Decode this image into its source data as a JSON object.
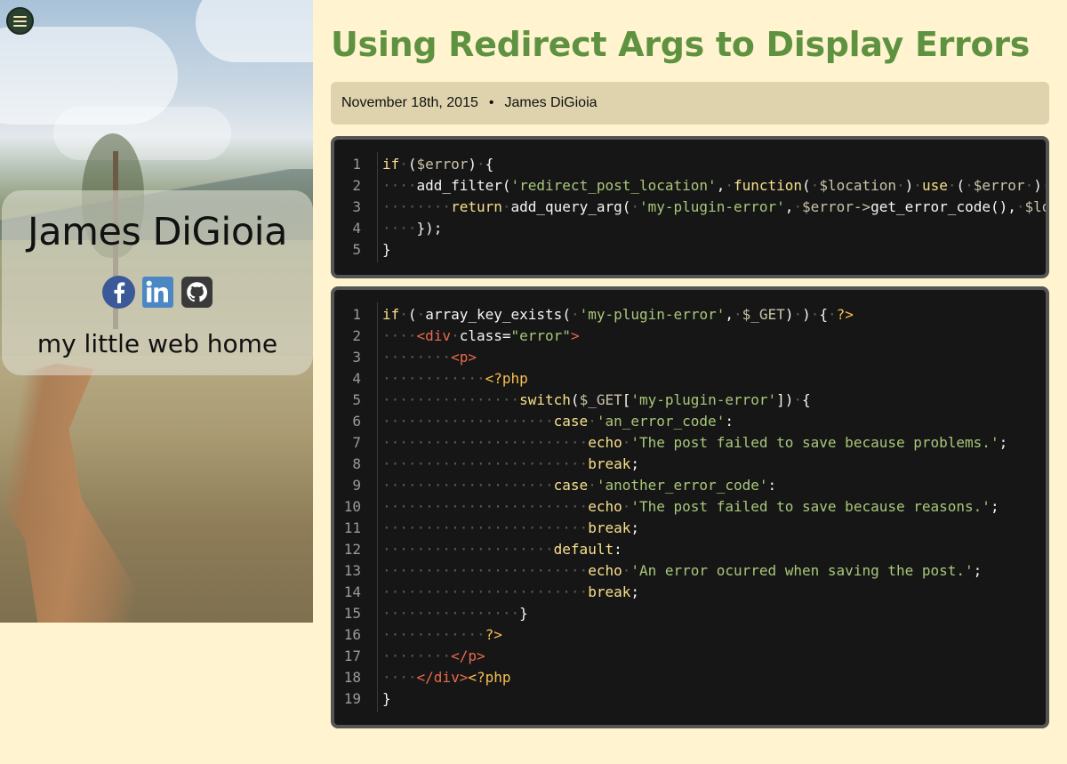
{
  "sidebar": {
    "menu_label": "menu",
    "author": "James DiGioia",
    "tagline": "my little web home",
    "social": [
      {
        "name": "facebook",
        "color": "#3b5998"
      },
      {
        "name": "linkedin",
        "color": "#4a87c3"
      },
      {
        "name": "github",
        "color": "#3a3a3a"
      }
    ]
  },
  "post": {
    "title": "Using Redirect Args to Display Errors",
    "date": "November 18th, 2015",
    "separator": "•",
    "author": "James DiGioia"
  },
  "code_blocks": [
    {
      "lines": [
        "if ($error) {",
        "    add_filter('redirect_post_location', function( $location ) use ( $error ) {",
        "        return add_query_arg( 'my-plugin-error', $error->get_error_code(), $location );",
        "    });",
        "}"
      ]
    },
    {
      "lines": [
        "if ( array_key_exists( 'my-plugin-error', $_GET) ) { ?>",
        "    <div class=\"error\">",
        "        <p>",
        "            <?php",
        "                switch($_GET['my-plugin-error']) {",
        "                    case 'an_error_code':",
        "                        echo 'The post failed to save because problems.';",
        "                        break;",
        "                    case 'another_error_code':",
        "                        echo 'The post failed to save because reasons.';",
        "                        break;",
        "                    default:",
        "                        echo 'An error ocurred when saving the post.';",
        "                        break;",
        "                }",
        "            ?>",
        "        </p>",
        "    </div><?php",
        "}"
      ]
    }
  ],
  "colors": {
    "background": "#fff4cf",
    "title": "#5f9240",
    "meta_bar": "#ded3ac",
    "code_bg": "#161616"
  }
}
